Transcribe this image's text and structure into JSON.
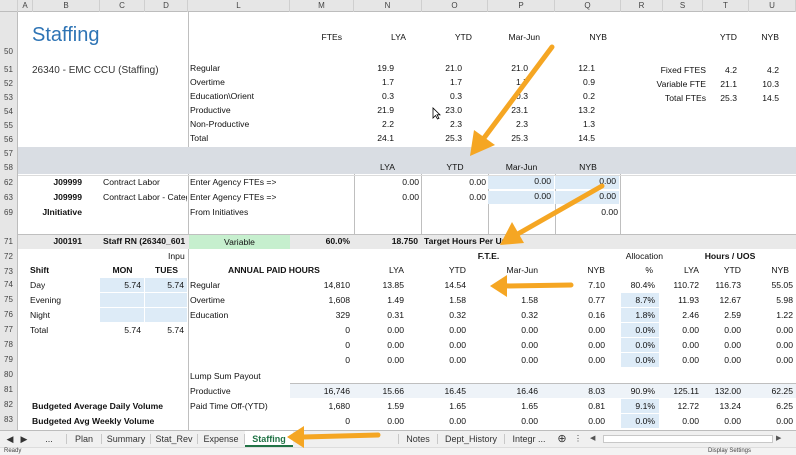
{
  "columns": [
    "A",
    "B",
    "C",
    "D",
    "L",
    "M",
    "N",
    "O",
    "P",
    "Q",
    "R",
    "S",
    "T",
    "U"
  ],
  "rows": [
    "50",
    "51",
    "52",
    "53",
    "54",
    "55",
    "56",
    "57",
    "58",
    "62",
    "63",
    "69",
    "71",
    "72",
    "73",
    "74",
    "75",
    "76",
    "77",
    "78",
    "79",
    "80",
    "81",
    "82",
    "83",
    "84",
    "85"
  ],
  "title": "Staffing",
  "subtitle": "26340 - EMC CCU (Staffing)",
  "top_headers": {
    "ftes": "FTEs",
    "lya": "LYA",
    "ytd": "YTD",
    "marjun": "Mar-Jun",
    "nyb": "NYB",
    "t_ytd": "YTD",
    "u_nyb": "NYB"
  },
  "top_rows": [
    {
      "label": "Regular",
      "m": "19.9",
      "n": "21.0",
      "o": "21.0",
      "p": "12.1"
    },
    {
      "label": "Overtime",
      "m": "1.7",
      "n": "1.7",
      "o": "1.7",
      "p": "0.9"
    },
    {
      "label": "Education\\Orient",
      "m": "0.3",
      "n": "0.3",
      "o": "0.3",
      "p": "0.2"
    },
    {
      "label": "Productive",
      "m": "21.9",
      "n": "23.0",
      "o": "23.1",
      "p": "13.2"
    },
    {
      "label": "Non-Productive",
      "m": "2.2",
      "n": "2.3",
      "o": "2.3",
      "p": "1.3"
    },
    {
      "label": "Total",
      "m": "24.1",
      "n": "25.3",
      "o": "25.3",
      "p": "14.5"
    }
  ],
  "fte_summary": [
    {
      "label": "Fixed FTES",
      "t": "4.2",
      "u": "4.2"
    },
    {
      "label": "Variable FTE",
      "t": "21.1",
      "u": "10.3"
    },
    {
      "label": "Total FTEs",
      "t": "25.3",
      "u": "14.5"
    }
  ],
  "band_headers": {
    "lya": "LYA",
    "ytd": "YTD",
    "marjun": "Mar-Jun",
    "nyb": "NYB"
  },
  "agency_rows": [
    {
      "code": "J09999",
      "desc": "Contract Labor",
      "label": "Enter Agency FTEs =>",
      "n": "0.00",
      "o": "0.00",
      "p": "0.00",
      "q": "0.00"
    },
    {
      "code": "J09999",
      "desc": "Contract Labor - Categ",
      "label": "Enter Agency FTEs =>",
      "n": "0.00",
      "o": "0.00",
      "p": "0.00",
      "q": "0.00"
    },
    {
      "code": "JInitiative",
      "desc": "",
      "label": "From Initiatives",
      "n": "",
      "o": "",
      "p": "",
      "q": "0.00"
    }
  ],
  "staff_row": {
    "code": "J00191",
    "desc": "Staff RN (26340_601",
    "variable": "Variable",
    "pct": "60.0%",
    "target": "18.750",
    "target_label": "Target Hours Per Un"
  },
  "fte_header": "F.T.E.",
  "input_label": "Inpu",
  "allocation_label": "Allocation",
  "hours_uos_label": "Hours / UOS",
  "shift_header": {
    "shift": "Shift",
    "mon": "MON",
    "tues": "TUES"
  },
  "annual_header": {
    "title": "ANNUAL PAID HOURS",
    "lya": "LYA",
    "ytd": "YTD",
    "marjun": "Mar-Jun",
    "nyb": "NYB",
    "pct": "%",
    "r_lya": "LYA",
    "r_ytd": "YTD",
    "r_nyb": "NYB"
  },
  "shifts": [
    {
      "name": "Day",
      "mon": "5.74",
      "tues": "5.74"
    },
    {
      "name": "Evening",
      "mon": "",
      "tues": ""
    },
    {
      "name": "Night",
      "mon": "",
      "tues": ""
    },
    {
      "name": "Total",
      "mon": "5.74",
      "tues": "5.74"
    }
  ],
  "annual_rows": [
    {
      "label": "Regular",
      "m": "14,810",
      "n": "13.85",
      "o": "14.54",
      "p": "",
      "q": "7.10",
      "pct": "80.4%",
      "s": "110.72",
      "t": "116.73",
      "u": "55.05"
    },
    {
      "label": "Overtime",
      "m": "1,608",
      "n": "1.49",
      "o": "1.58",
      "p": "1.58",
      "q": "0.77",
      "pct": "8.7%",
      "s": "11.93",
      "t": "12.67",
      "u": "5.98"
    },
    {
      "label": "Education",
      "m": "329",
      "n": "0.31",
      "o": "0.32",
      "p": "0.32",
      "q": "0.16",
      "pct": "1.8%",
      "s": "2.46",
      "t": "2.59",
      "u": "1.22"
    },
    {
      "label": "",
      "m": "0",
      "n": "0.00",
      "o": "0.00",
      "p": "0.00",
      "q": "0.00",
      "pct": "0.0%",
      "s": "0.00",
      "t": "0.00",
      "u": "0.00"
    },
    {
      "label": "",
      "m": "0",
      "n": "0.00",
      "o": "0.00",
      "p": "0.00",
      "q": "0.00",
      "pct": "0.0%",
      "s": "0.00",
      "t": "0.00",
      "u": "0.00"
    },
    {
      "label": "",
      "m": "0",
      "n": "0.00",
      "o": "0.00",
      "p": "0.00",
      "q": "0.00",
      "pct": "0.0%",
      "s": "0.00",
      "t": "0.00",
      "u": "0.00"
    }
  ],
  "lump_sum": "Lump Sum Payout",
  "productive_row": {
    "label": "Productive",
    "m": "16,746",
    "n": "15.66",
    "o": "16.45",
    "p": "16.46",
    "q": "8.03",
    "pct": "90.9%",
    "s": "125.11",
    "t": "132.00",
    "u": "62.25"
  },
  "pto_row": {
    "left": "Budgeted Average Daily Volume",
    "label": "Paid Time Off-(YTD)",
    "m": "1,680",
    "n": "1.59",
    "o": "1.65",
    "p": "1.65",
    "q": "0.81",
    "pct": "9.1%",
    "s": "12.72",
    "t": "13.24",
    "u": "6.25"
  },
  "last_row": {
    "left": "Budgeted Avg Weekly Volume",
    "m": "0",
    "n": "0.00",
    "o": "0.00",
    "p": "0.00",
    "q": "0.00",
    "pct": "0.0%",
    "s": "0.00",
    "t": "0.00",
    "u": "0.00"
  },
  "tabs": [
    "...",
    "Plan",
    "Summary",
    "Stat_Rev",
    "Expense",
    "Staffing",
    "Notes",
    "Dept_History",
    "Integr ..."
  ],
  "status": {
    "left": "Ready",
    "right": "Display Settings"
  },
  "colors": {
    "accent": "#217346",
    "arrow": "#f5a623",
    "title": "#2e74b5",
    "input": "#ddebf7",
    "variable": "#c6efce"
  }
}
